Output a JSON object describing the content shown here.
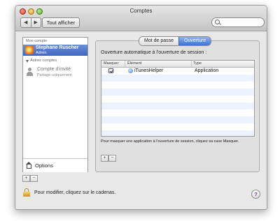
{
  "window": {
    "title": "Comptes"
  },
  "toolbar": {
    "back_label": "◀",
    "forward_label": "▶",
    "show_all_label": "Tout afficher",
    "search_placeholder": ""
  },
  "sidebar": {
    "my_account_header": "Mon compte",
    "current_user": {
      "name": "Stephane Ruscher",
      "role": "Admin"
    },
    "other_accounts_header": "Autres comptes",
    "guest": {
      "name": "Compte d'invité",
      "subtitle": "Partage uniquement"
    },
    "options_label": "Options",
    "add_label": "+",
    "remove_label": "−"
  },
  "tabs": [
    {
      "label": "Mot de passe",
      "selected": false
    },
    {
      "label": "Ouverture",
      "selected": true
    }
  ],
  "login_items": {
    "heading": "Ouverture automatique à l'ouverture de session :",
    "columns": {
      "hide": "Masquer",
      "item": "Élément",
      "type": "Type"
    },
    "rows": [
      {
        "hidden": true,
        "item": "iTunesHelper",
        "type": "Application",
        "icon": "itunes-helper-icon"
      }
    ],
    "help_text": "Pour masquer une application à l'ouverture de session, cliquez sa case Masquer.",
    "add_label": "+",
    "remove_label": "−"
  },
  "footer": {
    "lock_text": "Pour modifier, cliquez sur le cadenas.",
    "help_label": "?"
  },
  "colors": {
    "selection": "#3d66c4",
    "active_tab": "#3d73d8",
    "stripe": "#edf3fe"
  }
}
